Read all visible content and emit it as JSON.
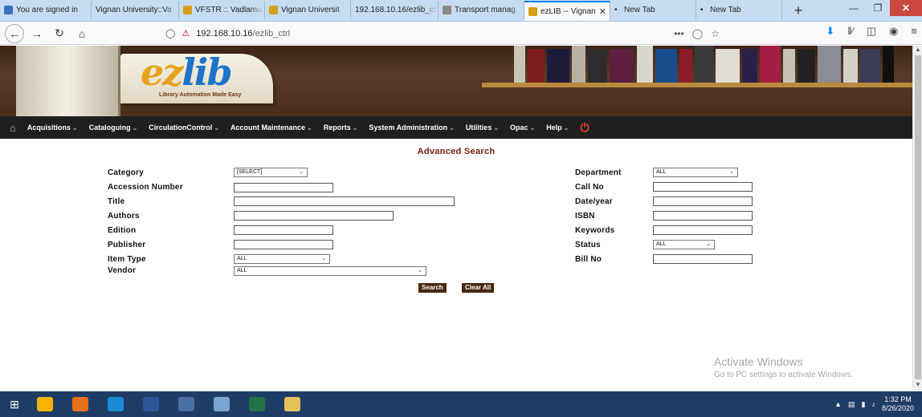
{
  "browser": {
    "tabs": [
      {
        "label": "You are signed in",
        "icon_color": "#3a6fc5",
        "width": 114
      },
      {
        "label": "Vignan University::Va",
        "icon_color": "",
        "width": 109
      },
      {
        "label": "VFSTR :: Vadlamu",
        "icon_color": "#d4a017",
        "width": 107
      },
      {
        "label": "Vignan Universit",
        "icon_color": "#d4a017",
        "width": 107
      },
      {
        "label": "192.168.10.16/ezlib_ct",
        "icon_color": "",
        "width": 109
      },
      {
        "label": "Transport manag",
        "icon_color": "#888888",
        "width": 107
      },
      {
        "label": "ezLIB -- Vignan",
        "icon_color": "#d4a017",
        "width": 107,
        "active": true
      },
      {
        "label": "New Tab",
        "icon_color": "",
        "width": 107,
        "dot": true
      },
      {
        "label": "New Tab",
        "icon_color": "",
        "width": 107,
        "dot": true
      }
    ],
    "new_tab_symbol": "+",
    "url_host": "192.168.10.16",
    "url_path": "/ezlib_ctrl",
    "url_menu": "•••"
  },
  "site": {
    "logo_main": "ez",
    "logo_accent": "lib",
    "tagline": "Library Automation Made Easy",
    "menu": [
      "Acquisitions",
      "Cataloguing",
      "CirculationControl",
      "Account Maintenance",
      "Reports",
      "System Administration",
      "Utilities",
      "Opac",
      "Help"
    ],
    "page_title": "Advanced Search"
  },
  "form": {
    "left": {
      "category": {
        "label": "Category",
        "value": "[SELECT]"
      },
      "accession": {
        "label": "Accession Number",
        "value": ""
      },
      "title": {
        "label": "Title",
        "value": ""
      },
      "authors": {
        "label": "Authors",
        "value": ""
      },
      "edition": {
        "label": "Edition",
        "value": ""
      },
      "publisher": {
        "label": "Publisher",
        "value": ""
      },
      "item_type": {
        "label": "Item Type",
        "value": "ALL"
      },
      "vendor": {
        "label": "Vendor",
        "value": "ALL"
      }
    },
    "right": {
      "department": {
        "label": "Department",
        "value": "ALL"
      },
      "call_no": {
        "label": "Call No",
        "value": ""
      },
      "date_year": {
        "label": "Date/year",
        "value": ""
      },
      "isbn": {
        "label": "ISBN",
        "value": ""
      },
      "keywords": {
        "label": "Keywords",
        "value": ""
      },
      "status": {
        "label": "Status",
        "value": "ALL"
      },
      "bill_no": {
        "label": "Bill No",
        "value": ""
      }
    },
    "search_button": "Search",
    "clear_button": "Clear All"
  },
  "watermark": {
    "line1": "Activate Windows",
    "line2": "Go to PC settings to activate Windows."
  },
  "taskbar": {
    "apps": [
      "#f4b400",
      "#e8711a",
      "#1a8ad4",
      "#2b579a",
      "#4a6fa5",
      "#7aa6d6",
      "#217346",
      "#e6c15a"
    ],
    "time": "1:32 PM",
    "date": "8/26/2020"
  }
}
